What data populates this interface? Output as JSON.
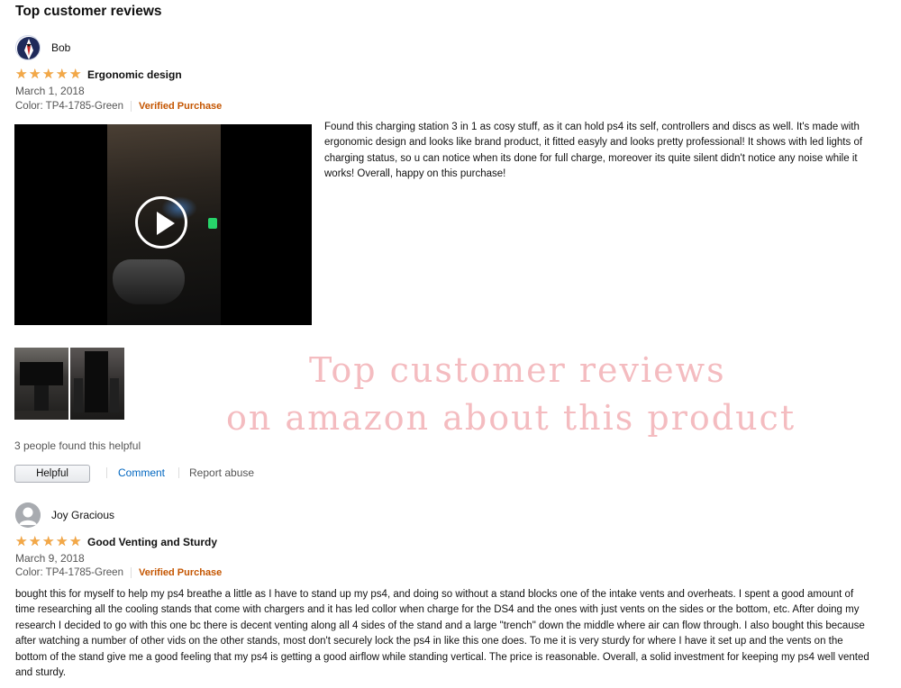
{
  "page": {
    "heading": "Top customer reviews"
  },
  "reviews": [
    {
      "reviewer": "Bob",
      "rating": 5,
      "title": "Ergonomic design",
      "date": "March 1, 2018",
      "color": "Color: TP4-1785-Green",
      "verified": "Verified Purchase",
      "text": " Found this charging station 3 in 1 as cosy stuff, as it can hold ps4 its self, controllers and discs as well. It's made with ergonomic design and looks like brand product, it fitted easyly and looks pretty professional! It shows with led lights of charging status, so u can notice when its done for full charge, moreover its quite silent didn't notice any noise while it works! Overall, happy on this purchase!",
      "helpful_count": "3 people found this helpful",
      "helpful_button": "Helpful",
      "comment_link": "Comment",
      "report_link": "Report abuse"
    },
    {
      "reviewer": "Joy Gracious",
      "rating": 5,
      "title": "Good Venting and Sturdy",
      "date": "March 9, 2018",
      "color": "Color: TP4-1785-Green",
      "verified": "Verified Purchase",
      "text": "bought this for myself to help my ps4 breathe a little as I have to stand up my ps4, and doing so without a stand blocks one of the intake vents and overheats. I spent a good amount of time researching all the cooling stands that come with chargers and it has led collor when charge for the DS4 and the ones with just vents on the sides or the bottom, etc. After doing my research I decided to go with this one bc there is decent venting along all 4 sides of the stand and a large \"trench\" down the middle where air can flow through. I also bought this because after watching a number of other vids on the other stands, most don't securely lock the ps4 in like this one does. To me it is very sturdy for where I have it set up and the vents on the bottom of the stand give me a good feeling that my ps4 is getting a good airflow while standing vertical. The price is reasonable. Overall, a solid investment for keeping my ps4 well vented and sturdy."
    }
  ],
  "watermark": {
    "line1": "Top customer reviews",
    "line2": "on amazon about this product"
  },
  "colors": {
    "star": "#f3a847",
    "verified": "#c45500",
    "link": "#0066c0",
    "watermark": "#f4bcc0"
  },
  "icons": {
    "star": "star-icon",
    "play": "play-icon",
    "avatar_default": "user-silhouette-icon"
  }
}
